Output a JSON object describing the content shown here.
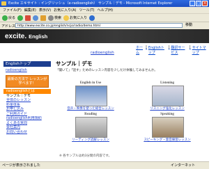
{
  "window": {
    "title": "Excite エキサイト : イングリッシュ（e-radioenglish） サンプル｜デモ - Microsoft Internet Explorer"
  },
  "menu": [
    "ファイル(F)",
    "編集(E)",
    "表示(V)",
    "お気に入り(A)",
    "ツール(T)",
    "ヘルプ(H)"
  ],
  "toolbar": {
    "back": "戻る",
    "search": "検索",
    "favorites": "お気に入り"
  },
  "address": {
    "label": "アドレス",
    "url": "http://www.excite.co.jp/english/ncjo/radio/demo.html",
    "go": "移動"
  },
  "brand": {
    "logo": "excite.",
    "service": "English"
  },
  "gnav": [
    "ホーム",
    "Englishトップ",
    "翻訳サービス",
    "サイトマップ"
  ],
  "breadcrumb": "radioenglish",
  "sidebar": {
    "header": "Englishトップ",
    "top_link": "radioenglish",
    "cta": "最新の方法で レッスンが学べます！",
    "items": [
      {
        "label": "radioenglishとは",
        "style": "active"
      },
      {
        "label": "サンプル｜デモ",
        "style": "cur"
      },
      {
        "label": "全体のレッスン",
        "style": "link"
      },
      {
        "label": "料金体系",
        "style": "link"
      },
      {
        "label": "お申し込み",
        "style": "link"
      },
      {
        "label": "ご利用ガイド",
        "style": "link"
      },
      {
        "label": "radioenglish利用規約",
        "style": "link"
      },
      {
        "label": "よくある質問",
        "style": "link"
      },
      {
        "label": "会社案内",
        "style": "link"
      },
      {
        "label": "お問い合わせ",
        "style": "link"
      }
    ]
  },
  "content": {
    "heading": "サンプル｜デモ",
    "intro": "「聞いて」「話す」ためのレッスン内容を少しだけ体験してみませんか。",
    "cards": [
      {
        "title": "English in Use",
        "caption": "音声・映像を使った総合レッスン"
      },
      {
        "title": "Listening",
        "caption": "リスニング強化レッスン"
      },
      {
        "title": "Reading",
        "caption": "リーディング読解レッスン"
      },
      {
        "title": "Speaking",
        "caption": "スピーキング・発音練習レッスン"
      }
    ],
    "footnote": "※ 各サンプルは約3分間の内容です。"
  },
  "status": {
    "left": "ページが表示されました",
    "right": "インターネット"
  }
}
